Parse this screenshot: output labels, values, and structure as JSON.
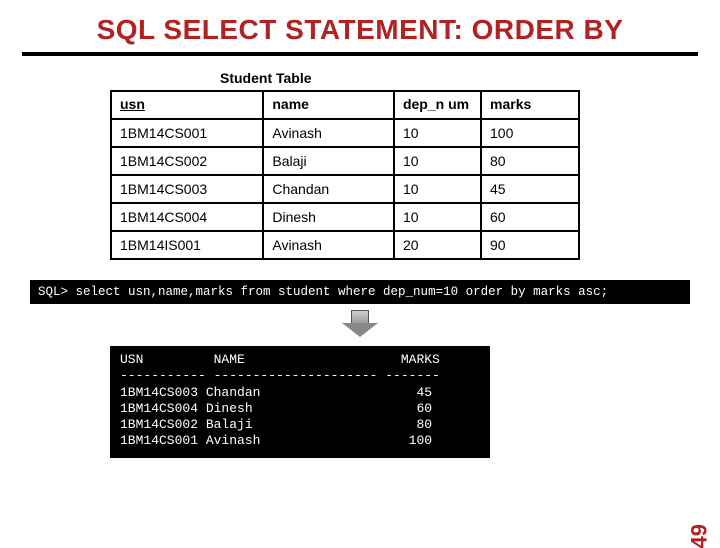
{
  "title": "SQL SELECT STATEMENT: ORDER BY",
  "table_label": "Student Table",
  "student_table": {
    "headers": {
      "usn": "usn",
      "name": "name",
      "dep_num": "dep_n\num",
      "marks": "marks"
    },
    "rows": [
      {
        "usn": "1BM14CS001",
        "name": "Avinash",
        "dep_num": "10",
        "marks": "100"
      },
      {
        "usn": "1BM14CS002",
        "name": "Balaji",
        "dep_num": "10",
        "marks": "80"
      },
      {
        "usn": "1BM14CS003",
        "name": "Chandan",
        "dep_num": "10",
        "marks": "45"
      },
      {
        "usn": "1BM14CS004",
        "name": "Dinesh",
        "dep_num": "10",
        "marks": "60"
      },
      {
        "usn": "1BM14IS001",
        "name": "Avinash",
        "dep_num": "20",
        "marks": "90"
      }
    ]
  },
  "sql_query": "SQL> select usn,name,marks from student where dep_num=10 order by marks asc;",
  "result": {
    "header": "USN         NAME                    MARKS",
    "rule": "----------- --------------------- -------",
    "rows": [
      "1BM14CS003 Chandan                    45",
      "1BM14CS004 Dinesh                     60",
      "1BM14CS002 Balaji                     80",
      "1BM14CS001 Avinash                   100"
    ]
  },
  "page_number": "49"
}
